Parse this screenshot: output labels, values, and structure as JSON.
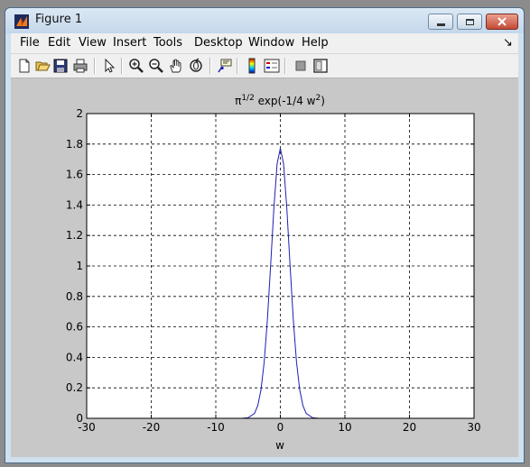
{
  "window": {
    "title": "Figure 1",
    "icon": "matlab-figure-icon",
    "controls": [
      "minimize",
      "maximize",
      "close"
    ]
  },
  "menubar": {
    "items": [
      "File",
      "Edit",
      "View",
      "Insert",
      "Tools",
      "Desktop",
      "Window",
      "Help"
    ],
    "dock_glyph": "↘"
  },
  "toolbar": {
    "icons": [
      "new-figure-icon",
      "open-file-icon",
      "save-icon",
      "print-icon",
      "edit-plot-arrow-icon",
      "zoom-in-icon",
      "zoom-out-icon",
      "pan-hand-icon",
      "rotate-3d-icon",
      "data-cursor-icon",
      "colorbar-icon",
      "legend-icon",
      "hide-plot-tools-icon",
      "show-plot-tools-icon"
    ]
  },
  "chart_data": {
    "type": "line",
    "title_main": "π",
    "title_sup1": "1/2",
    "title_mid": " exp(-1/4 w",
    "title_sup2": "2",
    "title_end": ")",
    "xlabel": "w",
    "ylabel": "",
    "xlim": [
      -30,
      30
    ],
    "ylim": [
      0,
      2
    ],
    "xticks": [
      "-30",
      "-20",
      "-10",
      "0",
      "10",
      "20",
      "30"
    ],
    "yticks": [
      "0",
      "0.2",
      "0.4",
      "0.6",
      "0.8",
      "1",
      "1.2",
      "1.4",
      "1.6",
      "1.8",
      "2"
    ],
    "xtick_values": [
      -30,
      -20,
      -10,
      0,
      10,
      20,
      30
    ],
    "ytick_values": [
      0,
      0.2,
      0.4,
      0.6,
      0.8,
      1,
      1.2,
      1.4,
      1.6,
      1.8,
      2
    ],
    "grid": true,
    "line_color": "#1f1fb4",
    "series": [
      {
        "x": [
          -12,
          -8,
          -6,
          -5,
          -4,
          -3.5,
          -3,
          -2.5,
          -2,
          -1.5,
          -1,
          -0.5,
          0,
          0.5,
          1,
          1.5,
          2,
          2.5,
          3,
          3.5,
          4,
          5,
          6,
          8,
          12
        ],
        "y": [
          0,
          0,
          0.0002,
          0.0034,
          0.0324,
          0.083,
          0.1871,
          0.3708,
          0.652,
          1.0069,
          1.3803,
          1.6708,
          1.7725,
          1.6708,
          1.3803,
          1.0069,
          0.652,
          0.3708,
          0.1871,
          0.083,
          0.0324,
          0.0034,
          0.0002,
          0,
          0
        ]
      }
    ]
  }
}
